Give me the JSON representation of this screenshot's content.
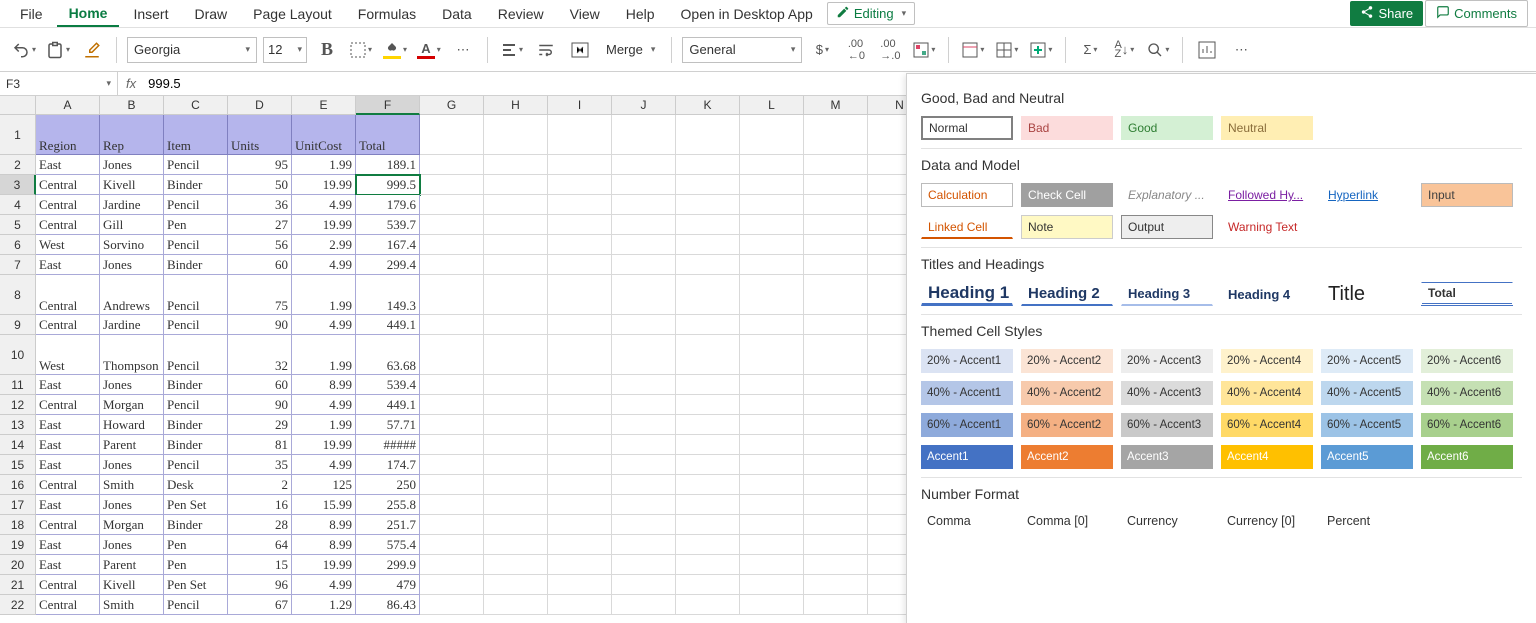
{
  "menu": [
    "File",
    "Home",
    "Insert",
    "Draw",
    "Page Layout",
    "Formulas",
    "Data",
    "Review",
    "View",
    "Help",
    "Open in Desktop App"
  ],
  "menu_active": 1,
  "editing_label": "Editing",
  "share_label": "Share",
  "comments_label": "Comments",
  "ribbon": {
    "font_name": "Georgia",
    "font_size": "12",
    "merge_label": "Merge",
    "num_format": "General"
  },
  "namebox": "F3",
  "formula": "999.5",
  "columns": [
    "A",
    "B",
    "C",
    "D",
    "E",
    "F",
    "G",
    "H",
    "I",
    "J",
    "K",
    "L",
    "M",
    "N"
  ],
  "active_col": 5,
  "active_row": 3,
  "headers": [
    "Region",
    "Rep",
    "Item",
    "Units",
    "UnitCost",
    "Total"
  ],
  "rows": [
    [
      "East",
      "Jones",
      "Pencil",
      "95",
      "1.99",
      "189.1"
    ],
    [
      "Central",
      "Kivell",
      "Binder",
      "50",
      "19.99",
      "999.5"
    ],
    [
      "Central",
      "Jardine",
      "Pencil",
      "36",
      "4.99",
      "179.6"
    ],
    [
      "Central",
      "Gill",
      "Pen",
      "27",
      "19.99",
      "539.7"
    ],
    [
      "West",
      "Sorvino",
      "Pencil",
      "56",
      "2.99",
      "167.4"
    ],
    [
      "East",
      "Jones",
      "Binder",
      "60",
      "4.99",
      "299.4"
    ],
    [
      "Central",
      "Andrews",
      "Pencil",
      "75",
      "1.99",
      "149.3"
    ],
    [
      "Central",
      "Jardine",
      "Pencil",
      "90",
      "4.99",
      "449.1"
    ],
    [
      "West",
      "Thompson",
      "Pencil",
      "32",
      "1.99",
      "63.68"
    ],
    [
      "East",
      "Jones",
      "Binder",
      "60",
      "8.99",
      "539.4"
    ],
    [
      "Central",
      "Morgan",
      "Pencil",
      "90",
      "4.99",
      "449.1"
    ],
    [
      "East",
      "Howard",
      "Binder",
      "29",
      "1.99",
      "57.71"
    ],
    [
      "East",
      "Parent",
      "Binder",
      "81",
      "19.99",
      "#####"
    ],
    [
      "East",
      "Jones",
      "Pencil",
      "35",
      "4.99",
      "174.7"
    ],
    [
      "Central",
      "Smith",
      "Desk",
      "2",
      "125",
      "250"
    ],
    [
      "East",
      "Jones",
      "Pen Set",
      "16",
      "15.99",
      "255.8"
    ],
    [
      "Central",
      "Morgan",
      "Binder",
      "28",
      "8.99",
      "251.7"
    ],
    [
      "East",
      "Jones",
      "Pen",
      "64",
      "8.99",
      "575.4"
    ],
    [
      "East",
      "Parent",
      "Pen",
      "15",
      "19.99",
      "299.9"
    ],
    [
      "Central",
      "Kivell",
      "Pen Set",
      "96",
      "4.99",
      "479"
    ],
    [
      "Central",
      "Smith",
      "Pencil",
      "67",
      "1.29",
      "86.43"
    ]
  ],
  "tall_rows": {
    "1": 2,
    "8": 2,
    "10": 2
  },
  "panel": {
    "sec1": "Good, Bad and Neutral",
    "styles1": [
      "Normal",
      "Bad",
      "Good",
      "Neutral"
    ],
    "sec2": "Data and Model",
    "styles2a": [
      "Calculation",
      "Check Cell",
      "Explanatory ...",
      "Followed Hy...",
      "Hyperlink",
      "Input"
    ],
    "styles2b": [
      "Linked Cell",
      "Note",
      "Output",
      "Warning Text"
    ],
    "sec3": "Titles and Headings",
    "styles3": [
      "Heading 1",
      "Heading 2",
      "Heading 3",
      "Heading 4",
      "Title",
      "Total"
    ],
    "sec4": "Themed Cell Styles",
    "accents": [
      {
        "pct": "20%",
        "bg": [
          "#dbe3f3",
          "#fbe4d5",
          "#ededed",
          "#fff2cc",
          "#deebf7",
          "#e2efd9"
        ],
        "fg": "#333"
      },
      {
        "pct": "40%",
        "bg": [
          "#b4c6e7",
          "#f7caac",
          "#dbdbdb",
          "#ffe599",
          "#bdd7ee",
          "#c5e0b3"
        ],
        "fg": "#333"
      },
      {
        "pct": "60%",
        "bg": [
          "#8eaadb",
          "#f4b083",
          "#c9c9c9",
          "#ffd966",
          "#9cc3e6",
          "#a8d08d"
        ],
        "fg": "#333"
      }
    ],
    "accent_solid_bg": [
      "#4472c4",
      "#ed7d31",
      "#a5a5a5",
      "#ffc000",
      "#5b9bd5",
      "#70ad47"
    ],
    "sec5": "Number Format",
    "formats": [
      "Comma",
      "Comma [0]",
      "Currency",
      "Currency [0]",
      "Percent"
    ]
  }
}
